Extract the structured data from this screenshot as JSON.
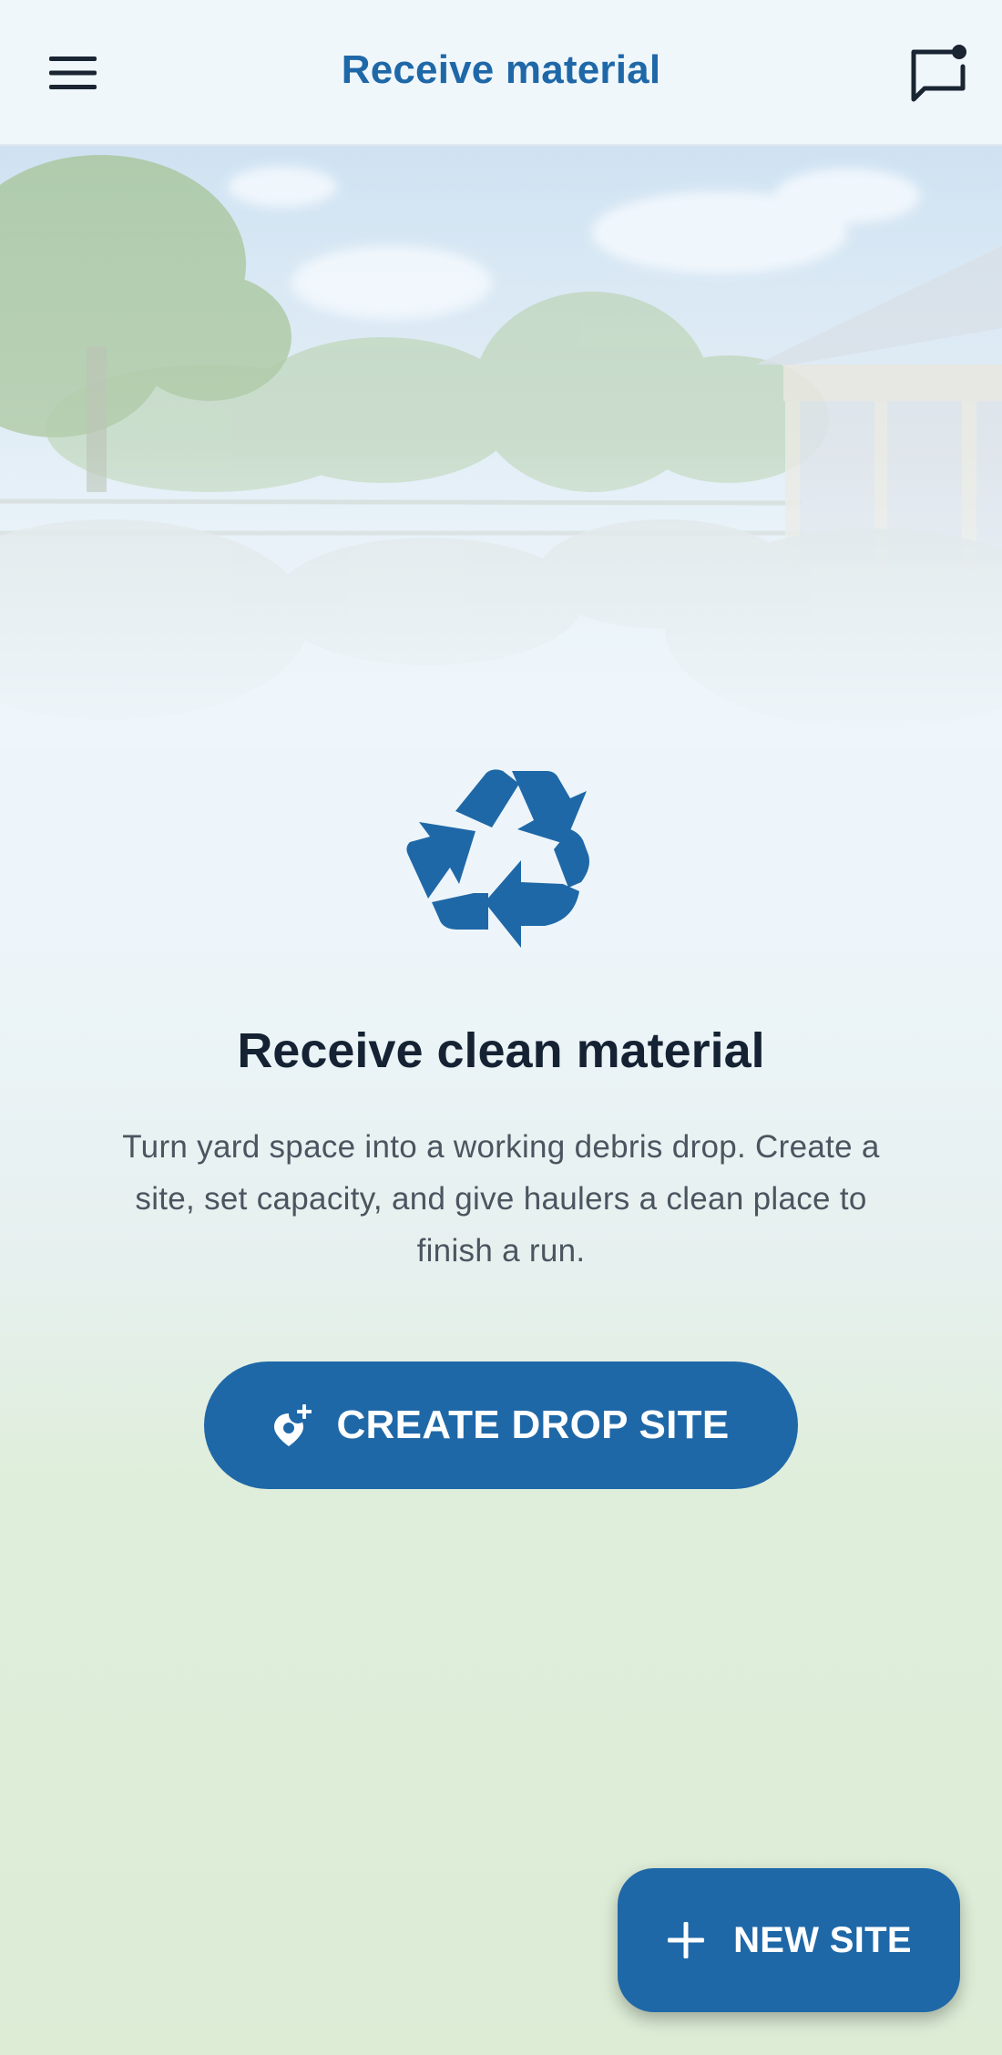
{
  "app_bar": {
    "title": "Receive material",
    "menu_icon": "hamburger-menu-icon",
    "chat_icon": "chat-notification-icon"
  },
  "hero": {
    "image": "yard-with-barn-and-debris-piles-illustration"
  },
  "empty_state": {
    "icon": "recycle-icon",
    "heading": "Receive clean material",
    "body_line1": "Turn yard space into a working debris drop. Create a",
    "body_line2": "site, set capacity, and give haulers a clean place to",
    "body_line3": "finish a run.",
    "cta_label": "CREATE DROP SITE",
    "cta_icon": "add-location-icon"
  },
  "fab": {
    "label": "NEW SITE",
    "icon": "plus-icon"
  },
  "colors": {
    "primary": "#1f68a8",
    "heading": "#142233",
    "body": "#4b5560",
    "app_bar_bg": "#f0f7fb"
  }
}
